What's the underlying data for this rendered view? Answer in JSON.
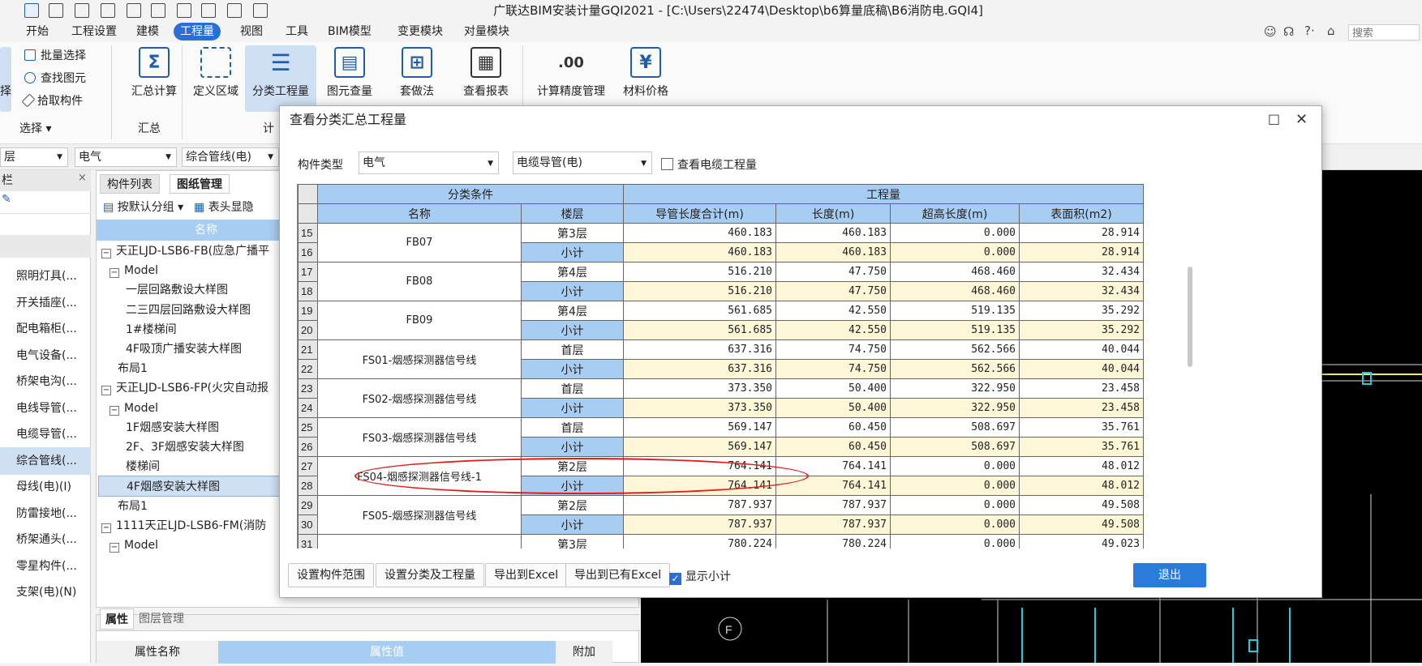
{
  "window": {
    "title": "广联达BIM安装计量GQI2021 - [C:\\Users\\22474\\Desktop\\b6算量底稿\\B6消防电.GQI4]"
  },
  "quick_access": [
    "app-icon",
    "new-icon",
    "open-icon",
    "save-icon",
    "undo-icon",
    "redo-icon",
    "sum-icon",
    "grid-icon",
    "list-icon",
    "export-icon"
  ],
  "menu": {
    "items": [
      "开始",
      "工程设置",
      "建模",
      "工程量",
      "视图",
      "工具",
      "BIM模型",
      "变更模块",
      "对量模块"
    ],
    "active": "工程量",
    "search_placeholder": "搜索"
  },
  "ribbon": {
    "select_group": {
      "label": "选择",
      "items": [
        "批量选择",
        "查找图元",
        "拾取构件"
      ],
      "cut_label": "择"
    },
    "summary_group": {
      "label": "汇总",
      "button": "汇总计算"
    },
    "calc_group": {
      "label": "计",
      "buttons": [
        "定义区域",
        "分类工程量",
        "图元查量",
        "套做法",
        "查看报表",
        "计算精度管理",
        "材料价格"
      ]
    }
  },
  "combobar": {
    "left_combo": "层",
    "type_combo": "电气",
    "item_combo": "综合管线(电)"
  },
  "leftnav": {
    "header": "栏",
    "items": [
      "照明灯具(...",
      "开关插座(...",
      "配电箱柜(...",
      "电气设备(...",
      "桥架电沟(...",
      "电线导管(...",
      "电缆导管(...",
      "综合管线(...",
      "母线(电)(I)",
      "防雷接地(...",
      "桥架通头(...",
      "零星构件(...",
      "支架(电)(N)"
    ],
    "selected": "综合管线(..."
  },
  "midpanel": {
    "tabs": [
      "构件列表",
      "图纸管理"
    ],
    "toolbar": [
      "按默认分组",
      "表头显隐"
    ],
    "column_header": "名称",
    "tree": [
      {
        "label": "天正LJD-LSB6-FB(应急广播平",
        "indent": 0,
        "box": "-"
      },
      {
        "label": "Model",
        "indent": 1,
        "box": "-"
      },
      {
        "label": "一层回路敷设大样图",
        "indent": 3,
        "box": ""
      },
      {
        "label": "二三四层回路敷设大样图",
        "indent": 3,
        "box": ""
      },
      {
        "label": "1#楼梯间",
        "indent": 3,
        "box": ""
      },
      {
        "label": "4F吸顶广播安装大样图",
        "indent": 3,
        "box": ""
      },
      {
        "label": "布局1",
        "indent": 2,
        "box": ""
      },
      {
        "label": "天正LJD-LSB6-FP(火灾自动报",
        "indent": 0,
        "box": "-"
      },
      {
        "label": "Model",
        "indent": 1,
        "box": "-"
      },
      {
        "label": "1F烟感安装大样图",
        "indent": 3,
        "box": ""
      },
      {
        "label": "2F、3F烟感安装大样图",
        "indent": 3,
        "box": ""
      },
      {
        "label": "楼梯间",
        "indent": 3,
        "box": ""
      },
      {
        "label": "4F烟感安装大样图",
        "indent": 3,
        "box": "",
        "selected": true
      },
      {
        "label": "布局1",
        "indent": 2,
        "box": ""
      },
      {
        "label": "1111天正LJD-LSB6-FM(消防",
        "indent": 0,
        "box": "-"
      },
      {
        "label": "Model",
        "indent": 1,
        "box": "-"
      }
    ]
  },
  "properties": {
    "tabs": [
      "属性",
      "图层管理"
    ],
    "columns": [
      "属性名称",
      "属性值",
      "附加"
    ]
  },
  "dialog": {
    "title": "查看分类汇总工程量",
    "type_label": "构件类型",
    "type_value": "电气",
    "subtype_value": "电缆导管(电)",
    "show_cable_label": "查看电缆工程量",
    "show_cable_checked": false,
    "headers": {
      "group1": "分类条件",
      "group2": "工程量",
      "name": "名称",
      "floor": "楼层",
      "cols": [
        "导管长度合计(m)",
        "长度(m)",
        "超高长度(m)",
        "表面积(m2)"
      ]
    },
    "rows": [
      {
        "no": "15",
        "name": "FB07",
        "floor": "第3层",
        "vals": [
          "460.183",
          "460.183",
          "0.000",
          "28.914"
        ]
      },
      {
        "no": "16",
        "name": "",
        "floor": "小计",
        "vals": [
          "460.183",
          "460.183",
          "0.000",
          "28.914"
        ]
      },
      {
        "no": "17",
        "name": "FB08",
        "floor": "第4层",
        "vals": [
          "516.210",
          "47.750",
          "468.460",
          "32.434"
        ]
      },
      {
        "no": "18",
        "name": "",
        "floor": "小计",
        "vals": [
          "516.210",
          "47.750",
          "468.460",
          "32.434"
        ]
      },
      {
        "no": "19",
        "name": "FB09",
        "floor": "第4层",
        "vals": [
          "561.685",
          "42.550",
          "519.135",
          "35.292"
        ]
      },
      {
        "no": "20",
        "name": "",
        "floor": "小计",
        "vals": [
          "561.685",
          "42.550",
          "519.135",
          "35.292"
        ]
      },
      {
        "no": "21",
        "name": "FS01-烟感探测器信号线",
        "floor": "首层",
        "vals": [
          "637.316",
          "74.750",
          "562.566",
          "40.044"
        ]
      },
      {
        "no": "22",
        "name": "",
        "floor": "小计",
        "vals": [
          "637.316",
          "74.750",
          "562.566",
          "40.044"
        ]
      },
      {
        "no": "23",
        "name": "FS02-烟感探测器信号线",
        "floor": "首层",
        "vals": [
          "373.350",
          "50.400",
          "322.950",
          "23.458"
        ]
      },
      {
        "no": "24",
        "name": "",
        "floor": "小计",
        "vals": [
          "373.350",
          "50.400",
          "322.950",
          "23.458"
        ]
      },
      {
        "no": "25",
        "name": "FS03-烟感探测器信号线",
        "floor": "首层",
        "vals": [
          "569.147",
          "60.450",
          "508.697",
          "35.761"
        ]
      },
      {
        "no": "26",
        "name": "",
        "floor": "小计",
        "vals": [
          "569.147",
          "60.450",
          "508.697",
          "35.761"
        ]
      },
      {
        "no": "27",
        "name": "FS04-烟感探测器信号线-1",
        "floor": "第2层",
        "vals": [
          "764.141",
          "764.141",
          "0.000",
          "48.012"
        ]
      },
      {
        "no": "28",
        "name": "",
        "floor": "小计",
        "vals": [
          "764.141",
          "764.141",
          "0.000",
          "48.012"
        ]
      },
      {
        "no": "29",
        "name": "FS05-烟感探测器信号线",
        "floor": "第2层",
        "vals": [
          "787.937",
          "787.937",
          "0.000",
          "49.508"
        ]
      },
      {
        "no": "30",
        "name": "",
        "floor": "小计",
        "vals": [
          "787.937",
          "787.937",
          "0.000",
          "49.508"
        ]
      },
      {
        "no": "31",
        "name": "",
        "floor": "第3层",
        "vals": [
          "780.224",
          "780.224",
          "0.000",
          "49.023"
        ]
      }
    ],
    "buttons": [
      "设置构件范围",
      "设置分类及工程量",
      "导出到Excel",
      "导出到已有Excel"
    ],
    "show_subtotal_label": "显示小计",
    "show_subtotal_checked": true,
    "exit_label": "退出"
  },
  "colors": {
    "accent": "#2b6fd6",
    "header_blue": "#a8cdf2",
    "subtotal_yellow": "#fdf7d8",
    "highlight_red": "#e21a1a"
  }
}
